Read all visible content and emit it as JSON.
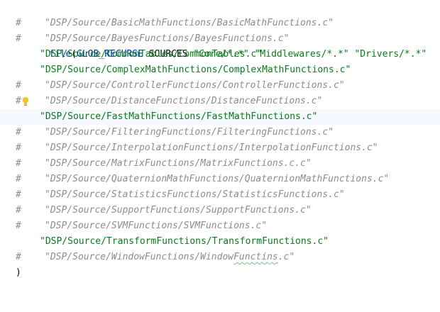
{
  "editor": {
    "header": {
      "command": "file",
      "open_paren": "(",
      "keyword": "GLOB_RECURSE",
      "variable": "SOURCES",
      "globs": [
        "\"Core/*.*\"",
        "\"Middlewares/*.*\"",
        "\"Drivers/*.*\""
      ]
    },
    "lines": [
      {
        "commented": true,
        "hash": "#",
        "text": "\"DSP/Source/BasicMathFunctions/BasicMathFunctions.c\""
      },
      {
        "commented": true,
        "hash": "#",
        "text": "\"DSP/Source/BayesFunctions/BayesFunctions.c\""
      },
      {
        "commented": false,
        "hash": "",
        "text": "\"DSP/Source/CommonTables/CommonTables.c\""
      },
      {
        "commented": false,
        "hash": "",
        "text": "\"DSP/Source/ComplexMathFunctions/ComplexMathFunctions.c\""
      },
      {
        "commented": true,
        "hash": "#",
        "text": "\"DSP/Source/ControllerFunctions/ControllerFunctions.c\""
      },
      {
        "commented": true,
        "hash": "#",
        "text": "\"DSP/Source/DistanceFunctions/DistanceFunctions.c\"",
        "intention_bulb": true
      },
      {
        "commented": false,
        "hash": "",
        "text": "\"DSP/Source/FastMathFunctions/FastMathFunctions.c\"",
        "current_line": true
      },
      {
        "commented": true,
        "hash": "#",
        "text": "\"DSP/Source/FilteringFunctions/FilteringFunctions.c\""
      },
      {
        "commented": true,
        "hash": "#",
        "text": "\"DSP/Source/InterpolationFunctions/InterpolationFunctions.c\""
      },
      {
        "commented": true,
        "hash": "#",
        "text": "\"DSP/Source/MatrixFunctions/MatrixFunctions.c.c\""
      },
      {
        "commented": true,
        "hash": "#",
        "text": "\"DSP/Source/QuaternionMathFunctions/QuaternionMathFunctions.c\""
      },
      {
        "commented": true,
        "hash": "#",
        "text": "\"DSP/Source/StatisticsFunctions/StatisticsFunctions.c\""
      },
      {
        "commented": true,
        "hash": "#",
        "text": "\"DSP/Source/SupportFunctions/SupportFunctions.c\""
      },
      {
        "commented": true,
        "hash": "#",
        "text": "\"DSP/Source/SVMFunctions/SVMFunctions.c\""
      },
      {
        "commented": false,
        "hash": "",
        "text": "\"DSP/Source/TransformFunctions/TransformFunctions.c\""
      },
      {
        "commented": true,
        "hash": "#",
        "text": "\"DSP/Source/WindowFunctions/WindowFunctins.c\"",
        "typo_word": "Functins"
      }
    ],
    "close_paren": ")"
  },
  "colors": {
    "keyword": "#0033b3",
    "string": "#067d17",
    "comment": "#8c8c8c",
    "current_line_bg": "#f5f8fe",
    "bulb": "#f2c12e"
  },
  "icons": {
    "intention_bulb": "lightbulb-icon"
  }
}
